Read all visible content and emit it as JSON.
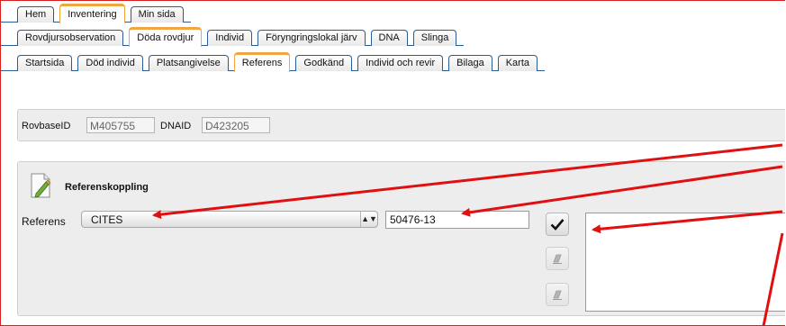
{
  "tabs_row1": [
    {
      "label": "Hem",
      "active": false
    },
    {
      "label": "Inventering",
      "active": true
    },
    {
      "label": "Min sida",
      "active": false
    }
  ],
  "tabs_row2": [
    {
      "label": "Rovdjursobservation",
      "active": false
    },
    {
      "label": "Döda rovdjur",
      "active": true
    },
    {
      "label": "Individ",
      "active": false
    },
    {
      "label": "Föryngringslokal järv",
      "active": false
    },
    {
      "label": "DNA",
      "active": false
    },
    {
      "label": "Slinga",
      "active": false
    }
  ],
  "tabs_row3": [
    {
      "label": "Startsida",
      "active": false
    },
    {
      "label": "Död individ",
      "active": false
    },
    {
      "label": "Platsangivelse",
      "active": false
    },
    {
      "label": "Referens",
      "active": true
    },
    {
      "label": "Godkänd",
      "active": false
    },
    {
      "label": "Individ och revir",
      "active": false
    },
    {
      "label": "Bilaga",
      "active": false
    },
    {
      "label": "Karta",
      "active": false
    }
  ],
  "ids": {
    "rovbase_label": "RovbaseID",
    "rovbase_value": "M405755",
    "dna_label": "DNAID",
    "dna_value": "D423205"
  },
  "reference": {
    "title": "Referenskoppling",
    "label": "Referens",
    "selected": "CITES",
    "number": "50476-13",
    "comment": ""
  },
  "icons": {
    "select_arrows": "up-down-arrows-icon",
    "confirm": "checkmark-icon",
    "edit": "eraser-icon",
    "doc": "document-pen-icon"
  },
  "colors": {
    "accent": "#f0a641",
    "tab_border": "#2a5d93",
    "annotation": "#e01010"
  }
}
